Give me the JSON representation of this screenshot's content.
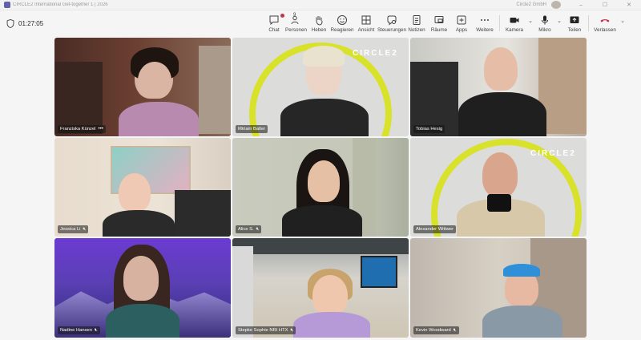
{
  "window": {
    "title": "CIRCLE2 International Get-together 1 | 2026",
    "org": "Circle2 GmbH",
    "window_controls": [
      "–",
      "☐",
      "✕"
    ]
  },
  "meeting": {
    "timer": "01:27:05"
  },
  "toolbar": {
    "items": [
      {
        "id": "chat",
        "label": "Chat",
        "icon": "chat-icon"
      },
      {
        "id": "people",
        "label": "Personen",
        "icon": "people-icon",
        "count": "9"
      },
      {
        "id": "raise",
        "label": "Heben",
        "icon": "hand-icon"
      },
      {
        "id": "react",
        "label": "Reagieren",
        "icon": "smiley-icon"
      },
      {
        "id": "view",
        "label": "Ansicht",
        "icon": "grid-icon"
      },
      {
        "id": "controls",
        "label": "Steuerungen",
        "icon": "controls-icon"
      },
      {
        "id": "notes",
        "label": "Notizen",
        "icon": "notes-icon"
      },
      {
        "id": "rooms",
        "label": "Räume",
        "icon": "rooms-icon"
      },
      {
        "id": "apps",
        "label": "Apps",
        "icon": "apps-icon"
      },
      {
        "id": "more",
        "label": "Weitere",
        "icon": "more-icon"
      }
    ],
    "camera_label": "Kamera",
    "mic_label": "Mikro",
    "share_label": "Teilen",
    "leave_label": "Verlassen"
  },
  "participants": [
    {
      "name": "Franziska Künzel",
      "extra": "•••",
      "muted": false
    },
    {
      "name": "Miriam Balter",
      "muted": false
    },
    {
      "name": "Tobias Hesig",
      "muted": false
    },
    {
      "name": "Jessica Li",
      "muted": true
    },
    {
      "name": "Alice S.",
      "muted": true
    },
    {
      "name": "Alexander Wittwer",
      "muted": false
    },
    {
      "name": "Nadine Hansen",
      "muted": true
    },
    {
      "name": "Stepke Sophie NRI HTX",
      "muted": true
    },
    {
      "name": "Kevin Woodward",
      "muted": true
    }
  ],
  "background_logo": "CIRCLE2",
  "colors": {
    "accent": "#6264a7",
    "leave": "#c4314b",
    "circle_yellow": "#d8e22a"
  }
}
